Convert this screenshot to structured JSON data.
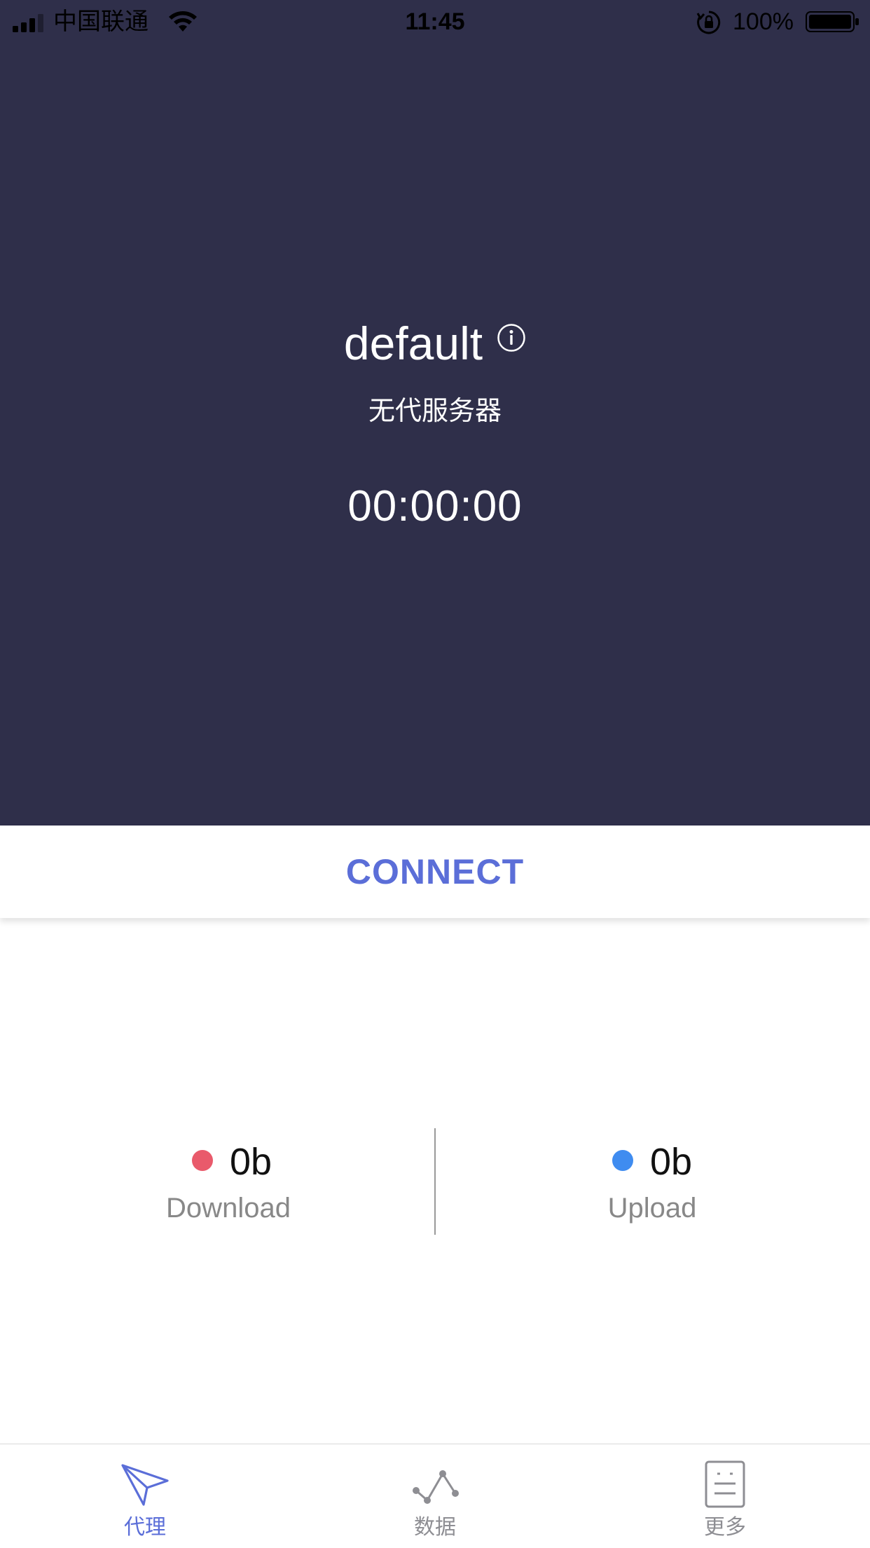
{
  "status_bar": {
    "carrier": "中国联通",
    "time": "11:45",
    "battery": "100%"
  },
  "profile": {
    "name": "default",
    "server": "无代服务器",
    "timer": "00:00:00"
  },
  "connect": {
    "label": "CONNECT"
  },
  "stats": {
    "download": {
      "value": "0b",
      "label": "Download"
    },
    "upload": {
      "value": "0b",
      "label": "Upload"
    }
  },
  "tabs": [
    {
      "label": "代理",
      "icon": "paper-plane-icon",
      "active": true
    },
    {
      "label": "数据",
      "icon": "line-graph-icon",
      "active": false
    },
    {
      "label": "更多",
      "icon": "document-icon",
      "active": false
    }
  ],
  "colors": {
    "hero_bg": "#2f2f4a",
    "accent": "#5b6ed8",
    "download_dot": "#e95a6b",
    "upload_dot": "#3f8cf0"
  }
}
